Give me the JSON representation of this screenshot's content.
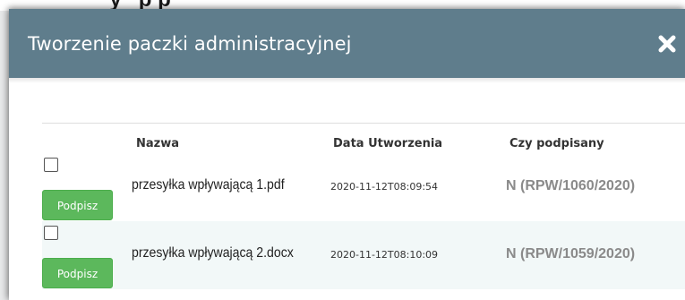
{
  "background": {
    "partial_text": "' y ' p    p  "
  },
  "modal": {
    "title": "Tworzenie paczki administracyjnej",
    "close_icon": "close-x-icon",
    "header_color": "#5f7d8c"
  },
  "table": {
    "headers": {
      "name": "Nazwa",
      "created": "Data Utworzenia",
      "signed": "Czy podpisany"
    },
    "rows": [
      {
        "name": "przesyłka wpływającą 1.pdf",
        "created": "2020-11-12T08:09:54",
        "signed": "N (RPW/1060/2020)",
        "button": "Podpisz"
      },
      {
        "name": "przesyłka wpływającą 2.docx",
        "created": "2020-11-12T08:10:09",
        "signed": "N (RPW/1059/2020)",
        "button": "Podpisz"
      }
    ]
  },
  "colors": {
    "button_green": "#5cb85c",
    "status_gray": "#8a8a8a",
    "alt_row": "#f2f8f8"
  }
}
